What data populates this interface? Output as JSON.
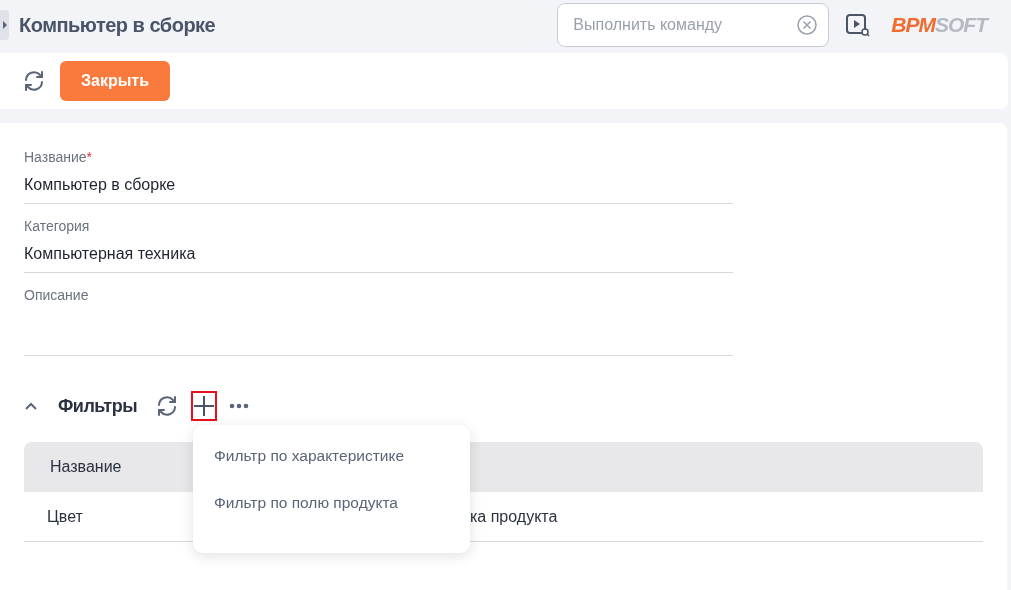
{
  "header": {
    "title": "Компьютер в сборке",
    "command_field": {
      "placeholder": "Выполнить команду"
    },
    "logo": {
      "part_1": "BPM",
      "part_2": "SOFT"
    }
  },
  "toolbar": {
    "close_button": "Закрыть"
  },
  "fields": [
    {
      "label": "Название",
      "required_mark": "*",
      "value": "Компьютер в сборке"
    },
    {
      "label": "Категория",
      "value": "Компьютерная техника"
    },
    {
      "label": "Описание"
    }
  ],
  "filters": {
    "title": "Фильтры",
    "expanded": true,
    "add_highlighted": true,
    "table": {
      "columns": [
        "Название"
      ],
      "rows": [
        [
          "Цвет",
          "ка продукта"
        ]
      ]
    },
    "menu": [
      {
        "label": "Фильтр по характеристике"
      },
      {
        "label": "Фильтр по полю продукта"
      }
    ]
  }
}
